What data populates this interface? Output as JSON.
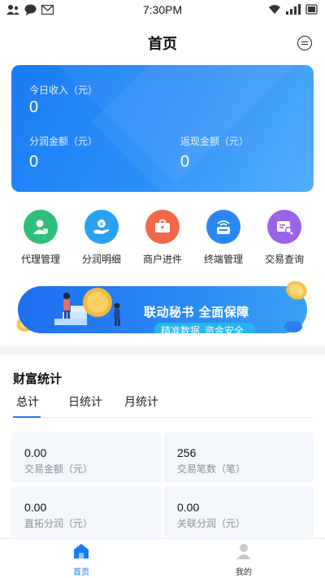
{
  "status_bar": {
    "time": "7:30PM"
  },
  "header": {
    "title": "首页"
  },
  "income": {
    "today_label": "今日收入（元）",
    "today_value": "0",
    "share_label": "分润金额（元）",
    "share_value": "0",
    "cashback_label": "返现金额（元）",
    "cashback_value": "0"
  },
  "quick_nav": [
    {
      "label": "代理管理",
      "icon": "agent-icon",
      "color": "#2fbf7a"
    },
    {
      "label": "分润明细",
      "icon": "money-hand-icon",
      "color": "#27a3f1"
    },
    {
      "label": "商户进件",
      "icon": "briefcase-icon",
      "color": "#f2684a"
    },
    {
      "label": "终端管理",
      "icon": "terminal-icon",
      "color": "#2a86f3"
    },
    {
      "label": "交易查询",
      "icon": "transaction-search-icon",
      "color": "#9a63e8"
    }
  ],
  "banner": {
    "title": "联动秘书 全面保障",
    "tag1": "精准数据",
    "tag2": "资金安全"
  },
  "stats": {
    "title": "财富统计",
    "tabs": [
      "总计",
      "日统计",
      "月统计"
    ],
    "cards": [
      {
        "value": "0.00",
        "label": "交易金额（元）"
      },
      {
        "value": "256",
        "label": "交易笔数（笔）"
      },
      {
        "value": "0.00",
        "label": "直拓分润（元）"
      },
      {
        "value": "0.00",
        "label": "关联分润（元）"
      }
    ]
  },
  "tabbar": [
    {
      "label": "首页",
      "icon": "home-icon",
      "active": true
    },
    {
      "label": "我的",
      "icon": "user-icon",
      "active": false
    }
  ],
  "colors": {
    "accent": "#1a7cf6"
  }
}
